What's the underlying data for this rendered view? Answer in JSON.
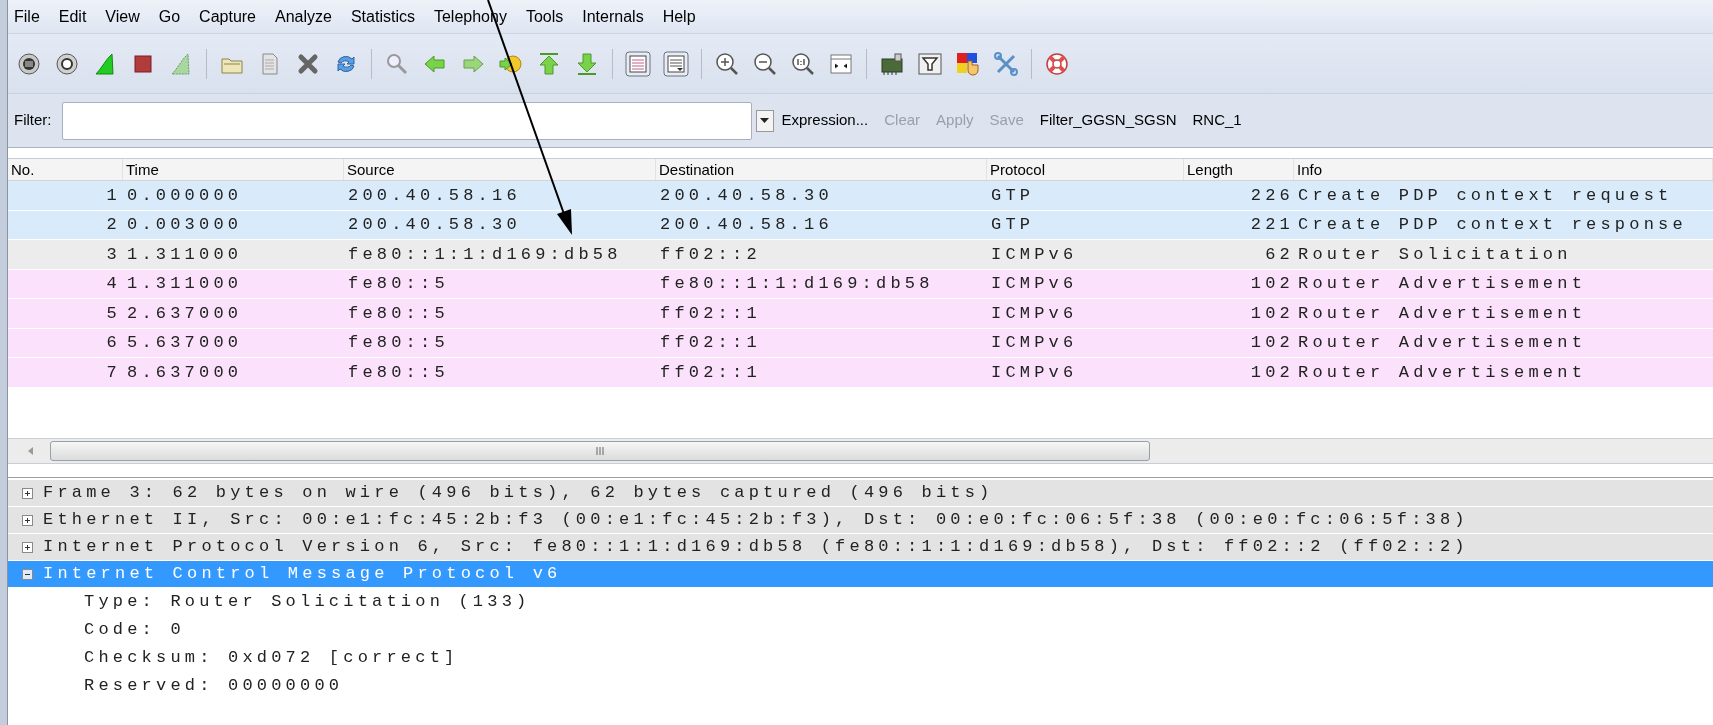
{
  "menu": [
    "File",
    "Edit",
    "View",
    "Go",
    "Capture",
    "Analyze",
    "Statistics",
    "Telephony",
    "Tools",
    "Internals",
    "Help"
  ],
  "filter_bar": {
    "label": "Filter:",
    "buttons": [
      {
        "label": "Expression...",
        "disabled": false
      },
      {
        "label": "Clear",
        "disabled": true
      },
      {
        "label": "Apply",
        "disabled": true
      },
      {
        "label": "Save",
        "disabled": true
      }
    ],
    "saved_filters": [
      "Filter_GGSN_SGSN",
      "RNC_1"
    ]
  },
  "packet_list": {
    "columns": [
      "No.",
      "Time",
      "Source",
      "Destination",
      "Protocol",
      "Length",
      "Info"
    ],
    "rows": [
      {
        "no": "1",
        "time": "0.000000",
        "source": "200.40.58.16",
        "destination": "200.40.58.30",
        "protocol": "GTP",
        "length": "226",
        "info": "Create PDP context request",
        "color": "#d9ebfa"
      },
      {
        "no": "2",
        "time": "0.003000",
        "source": "200.40.58.30",
        "destination": "200.40.58.16",
        "protocol": "GTP",
        "length": "221",
        "info": "Create PDP context response",
        "color": "#d9ebfa"
      },
      {
        "no": "3",
        "time": "1.311000",
        "source": "fe80::1:1:d169:db58",
        "destination": "ff02::2",
        "protocol": "ICMPv6",
        "length": "62",
        "info": "Router Solicitation",
        "color": "#ececec"
      },
      {
        "no": "4",
        "time": "1.311000",
        "source": "fe80::5",
        "destination": "fe80::1:1:d169:db58",
        "protocol": "ICMPv6",
        "length": "102",
        "info": "Router Advertisement",
        "color": "#fbe1fb"
      },
      {
        "no": "5",
        "time": "2.637000",
        "source": "fe80::5",
        "destination": "ff02::1",
        "protocol": "ICMPv6",
        "length": "102",
        "info": "Router Advertisement",
        "color": "#fbe1fb"
      },
      {
        "no": "6",
        "time": "5.637000",
        "source": "fe80::5",
        "destination": "ff02::1",
        "protocol": "ICMPv6",
        "length": "102",
        "info": "Router Advertisement",
        "color": "#fbe1fb"
      },
      {
        "no": "7",
        "time": "8.637000",
        "source": "fe80::5",
        "destination": "ff02::1",
        "protocol": "ICMPv6",
        "length": "102",
        "info": "Router Advertisement",
        "color": "#fbe1fb"
      }
    ]
  },
  "details": [
    {
      "text": "Frame 3: 62 bytes on wire (496 bits), 62 bytes captured (496 bits)",
      "expanded": false,
      "selected": false
    },
    {
      "text": "Ethernet II, Src: 00:e1:fc:45:2b:f3 (00:e1:fc:45:2b:f3), Dst: 00:e0:fc:06:5f:38 (00:e0:fc:06:5f:38)",
      "expanded": false,
      "selected": false
    },
    {
      "text": "Internet Protocol Version 6, Src: fe80::1:1:d169:db58 (fe80::1:1:d169:db58), Dst: ff02::2 (ff02::2)",
      "expanded": false,
      "selected": false
    },
    {
      "text": "Internet Control Message Protocol v6",
      "expanded": true,
      "selected": true,
      "children": [
        {
          "text": "Type: Router Solicitation (133)"
        },
        {
          "text": "Code: 0"
        },
        {
          "text": "Checksum: 0xd072 [correct]"
        },
        {
          "text": "Reserved: 00000000"
        }
      ]
    }
  ]
}
